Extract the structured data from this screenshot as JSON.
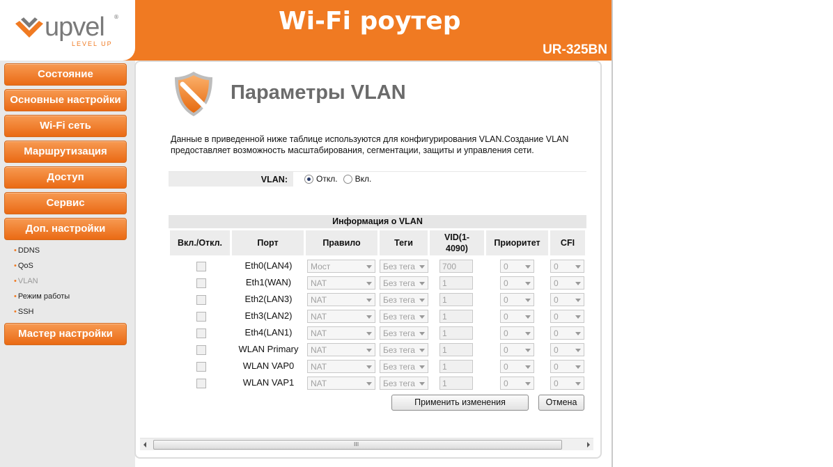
{
  "brand": {
    "logo_text": "upvel",
    "logo_tagline": "LEVEL UP",
    "logo_reg": "®",
    "accent_color": "#f07a22"
  },
  "header": {
    "title": "Wi-Fi роутер",
    "model": "UR-325BN"
  },
  "sidebar": {
    "main_items": [
      {
        "label": "Состояние"
      },
      {
        "label": "Основные настройки"
      },
      {
        "label": "Wi-Fi сеть"
      },
      {
        "label": "Маршрутизация"
      },
      {
        "label": "Доступ"
      },
      {
        "label": "Сервис"
      },
      {
        "label": "Доп. настройки"
      }
    ],
    "sub_items": [
      {
        "label": "DDNS"
      },
      {
        "label": "QoS"
      },
      {
        "label": "VLAN",
        "active": true
      },
      {
        "label": "Режим работы"
      },
      {
        "label": "SSH"
      }
    ],
    "wizard": {
      "label": "Мастер настройки"
    }
  },
  "page": {
    "title": "Параметры VLAN",
    "description": "Данные в приведенной ниже таблице используются для конфигурирования VLAN.Создание VLAN предоставляет возможность масштабирования, сегментации, защиты и управления сети.",
    "vlan_label": "VLAN:",
    "vlan_options": [
      {
        "label": "Откл.",
        "checked": true
      },
      {
        "label": "Вкл.",
        "checked": false
      }
    ]
  },
  "table": {
    "section_title": "Информация о VLAN",
    "headers": {
      "enable": "Вкл./Откл.",
      "port": "Порт",
      "rule": "Правило",
      "tags": "Теги",
      "vid_line1": "VID(1-",
      "vid_line2": "4090)",
      "priority": "Приоритет",
      "cfi": "CFI"
    },
    "rows": [
      {
        "enabled": false,
        "port": "Eth0(LAN4)",
        "rule": "Мост",
        "tags": "Без тега",
        "vid": "700",
        "priority": "0",
        "cfi": "0"
      },
      {
        "enabled": false,
        "port": "Eth1(WAN)",
        "rule": "NAT",
        "tags": "Без тега",
        "vid": "1",
        "priority": "0",
        "cfi": "0"
      },
      {
        "enabled": false,
        "port": "Eth2(LAN3)",
        "rule": "NAT",
        "tags": "Без тега",
        "vid": "1",
        "priority": "0",
        "cfi": "0"
      },
      {
        "enabled": false,
        "port": "Eth3(LAN2)",
        "rule": "NAT",
        "tags": "Без тега",
        "vid": "1",
        "priority": "0",
        "cfi": "0"
      },
      {
        "enabled": false,
        "port": "Eth4(LAN1)",
        "rule": "NAT",
        "tags": "Без тега",
        "vid": "1",
        "priority": "0",
        "cfi": "0"
      },
      {
        "enabled": false,
        "port": "WLAN Primary",
        "rule": "NAT",
        "tags": "Без тега",
        "vid": "1",
        "priority": "0",
        "cfi": "0"
      },
      {
        "enabled": false,
        "port": "WLAN VAP0",
        "rule": "NAT",
        "tags": "Без тега",
        "vid": "1",
        "priority": "0",
        "cfi": "0"
      },
      {
        "enabled": false,
        "port": "WLAN VAP1",
        "rule": "NAT",
        "tags": "Без тега",
        "vid": "1",
        "priority": "0",
        "cfi": "0"
      }
    ]
  },
  "actions": {
    "apply_label": "Применить изменения",
    "cancel_label": "Отмена"
  },
  "scrollbar": {
    "grip": "III"
  }
}
